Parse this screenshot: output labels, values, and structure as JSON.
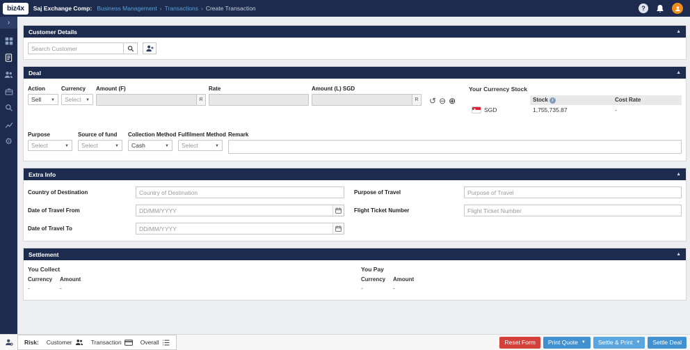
{
  "colors": {
    "navy": "#1c2b4e",
    "link": "#5aa2d8",
    "red": "#d4403a",
    "blue": "#4191d1",
    "light_blue": "#5aa7e0",
    "orange": "#ee8c1d"
  },
  "topbar": {
    "logo": "biz4x",
    "company": "Saj Exchange Comp:",
    "separator": "›",
    "help_glyph": "?",
    "breadcrumbs": [
      {
        "label": "Business Management"
      },
      {
        "label": "Transactions"
      },
      {
        "label": "Create Transaction"
      }
    ]
  },
  "sidebar": {
    "expand_glyph": "›",
    "items": [
      {
        "icon": "dashboard-icon"
      },
      {
        "icon": "documents-icon"
      },
      {
        "icon": "customers-icon"
      },
      {
        "icon": "briefcase-icon"
      },
      {
        "icon": "search-icon"
      },
      {
        "icon": "chart-icon"
      },
      {
        "icon": "gear-icon"
      }
    ],
    "bottom_icon": "user-settings-icon"
  },
  "customer": {
    "title": "Customer Details",
    "search_placeholder": "Search Customer"
  },
  "deal": {
    "title": "Deal",
    "action_label": "Action",
    "action_value": "Sell",
    "currency_label": "Currency",
    "currency_value": "Select",
    "amount_f_label": "Amount (F)",
    "rate_label": "Rate",
    "amount_l_label": "Amount (L) SGD",
    "rate_toggle": "R",
    "purpose_label": "Purpose",
    "purpose_value": "Select",
    "source_label": "Source of fund",
    "source_value": "Select",
    "collection_label": "Collection Method",
    "collection_value": "Cash",
    "fulfilment_label": "Fulfilment Method",
    "fulfilment_value": "Select",
    "remark_label": "Remark",
    "stock": {
      "title": "Your Currency Stock",
      "info_glyph": "i",
      "stock_header": "Stock",
      "cost_rate_header": "Cost Rate",
      "currency": "SGD",
      "stock_value": "1,755,735.87",
      "cost_rate_value": "-"
    }
  },
  "extra": {
    "title": "Extra Info",
    "country_label": "Country of Destination",
    "country_placeholder": "Country of Destination",
    "purpose_travel_label": "Purpose of Travel",
    "purpose_travel_placeholder": "Purpose of Travel",
    "date_from_label": "Date of Travel From",
    "date_to_label": "Date of Travel To",
    "date_placeholder": "DD/MM/YYYY",
    "flight_label": "Flight Ticket Number",
    "flight_placeholder": "Flight Ticket Number"
  },
  "settlement": {
    "title": "Settlement",
    "collect_title": "You Collect",
    "pay_title": "You Pay",
    "currency_header": "Currency",
    "amount_header": "Amount",
    "collect_currency": "-",
    "collect_amount": "-",
    "pay_currency": "-",
    "pay_amount": "-"
  },
  "footer": {
    "risk_label": "Risk:",
    "risk_items": [
      {
        "label": "Customer",
        "icon": "customers-icon"
      },
      {
        "label": "Transaction",
        "icon": "card-icon"
      },
      {
        "label": "Overall",
        "icon": "list-icon"
      }
    ],
    "buttons": [
      {
        "label": "Reset Form",
        "style": "red",
        "dropdown": false
      },
      {
        "label": "Print Quote",
        "style": "blue",
        "dropdown": true
      },
      {
        "label": "Settle & Print",
        "style": "light_blue",
        "dropdown": true
      },
      {
        "label": "Settle Deal",
        "style": "blue",
        "dropdown": false
      }
    ]
  }
}
